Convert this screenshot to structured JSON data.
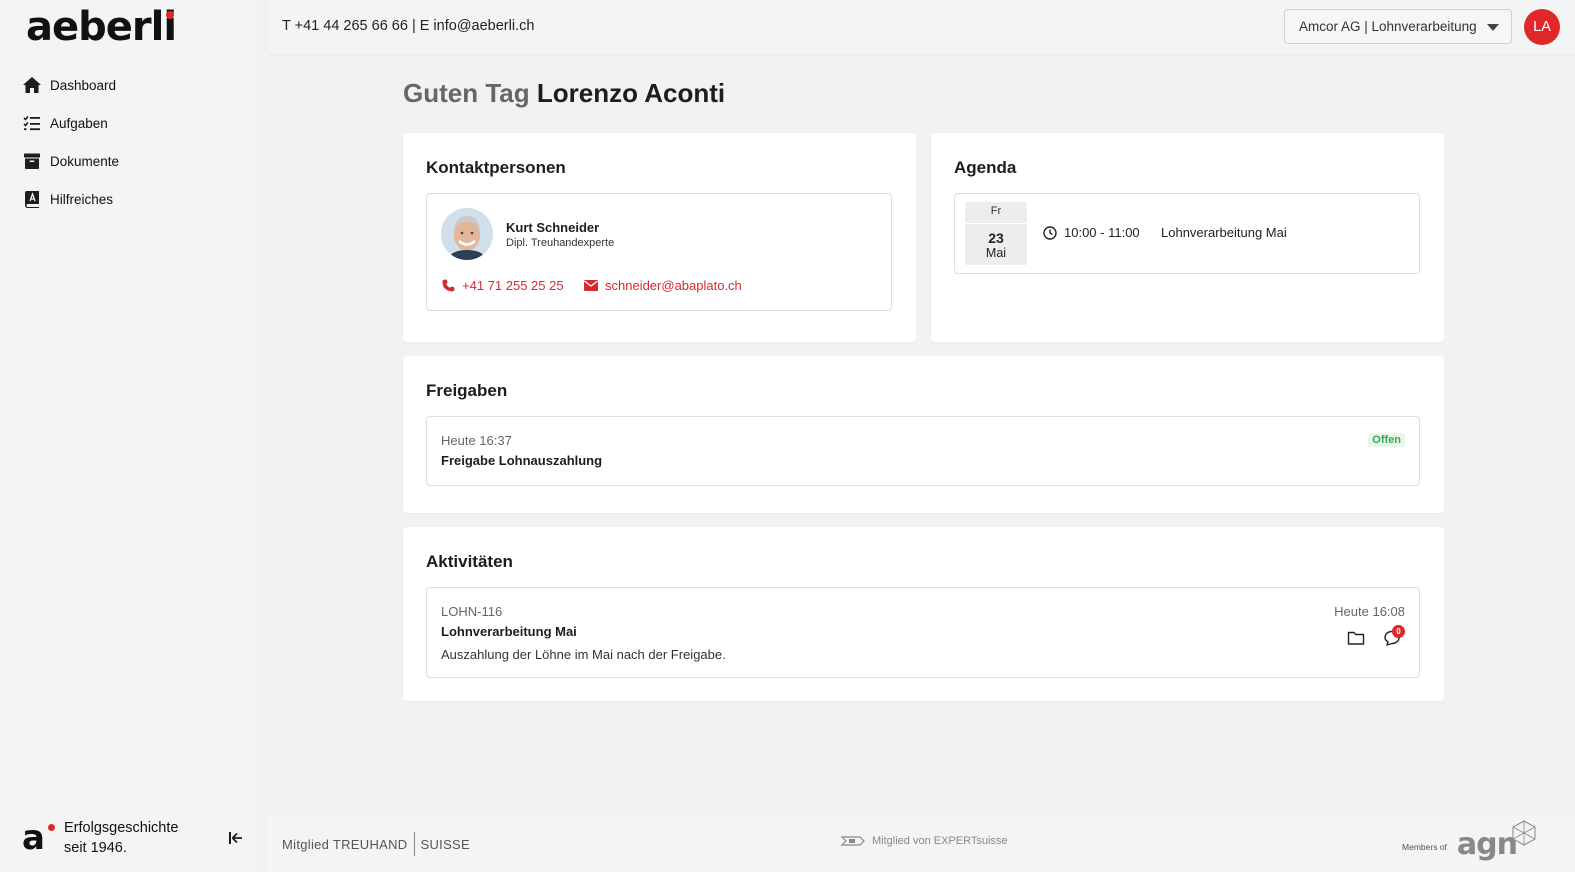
{
  "app": {
    "logo_text_main": "aeberl",
    "logo_text_last": "i"
  },
  "sidebar": {
    "items": [
      {
        "label": "Dashboard",
        "icon": "home-icon"
      },
      {
        "label": "Aufgaben",
        "icon": "checklist-icon"
      },
      {
        "label": "Dokumente",
        "icon": "archive-icon"
      },
      {
        "label": "Hilfreiches",
        "icon": "book-icon"
      }
    ],
    "footer_brand": "a",
    "tagline": "Erfolgsgeschichte seit 1946."
  },
  "topbar": {
    "contact": "T +41 44 265 66 66 | E info@aeberli.ch",
    "company_select": "Amcor AG | Lohnverarbeitung",
    "user_initials": "LA"
  },
  "greeting": {
    "prefix": "Guten Tag",
    "name": "Lorenzo Aconti"
  },
  "contacts": {
    "title": "Kontaktpersonen",
    "person": {
      "name": "Kurt Schneider",
      "role": "Dipl. Treuhandexperte",
      "phone": "+41 71 255 25 25",
      "email": "schneider@abaplato.ch"
    }
  },
  "agenda": {
    "title": "Agenda",
    "event": {
      "weekday": "Fr",
      "day": "23",
      "month": "Mai",
      "time": "10:00 - 11:00",
      "title": "Lohnverarbeitung Mai"
    }
  },
  "releases": {
    "title": "Freigaben",
    "item": {
      "time": "Heute 16:37",
      "title": "Freigabe Lohnauszahlung",
      "status": "Offen"
    }
  },
  "activities": {
    "title": "Aktivitäten",
    "item": {
      "code": "LOHN-116",
      "title": "Lohnverarbeitung Mai",
      "description": "Auszahlung der Löhne im Mai nach der Freigabe.",
      "time": "Heute 16:08",
      "comment_count": "0"
    }
  },
  "footer": {
    "treuhand_left": "Mitglied TREUHAND",
    "treuhand_right": "SUISSE",
    "expert": "Mitglied von EXPERTsuisse",
    "members_of": "Members of",
    "agn": "agn"
  },
  "colors": {
    "accent": "#e0272a",
    "link": "#d82a2e",
    "status_open": "#3aa54f"
  }
}
